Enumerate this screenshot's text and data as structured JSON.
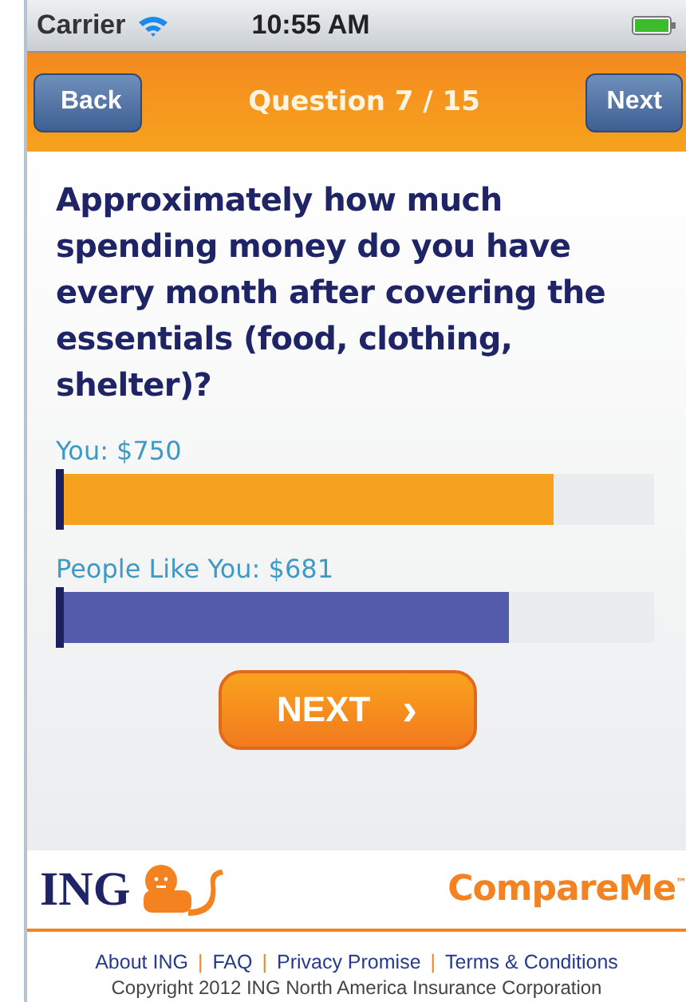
{
  "status_bar": {
    "carrier": "Carrier",
    "time": "10:55 AM"
  },
  "nav_bar": {
    "back": "Back",
    "title": "Question 7 / 15",
    "next": "Next"
  },
  "question": "Approximately how much spending money do you have every month after covering the essentials (food, clothing, shelter)?",
  "results": [
    {
      "label": "You: $750",
      "level": 0.83,
      "color": "#f7a21e"
    },
    {
      "label": "People Like You: $681",
      "level": 0.755,
      "color": "#535bab"
    }
  ],
  "next_button": "NEXT",
  "next_arrow": "›",
  "logos": {
    "brand": "ING",
    "product": "CompareMe$^{™}$"
  },
  "footer_links": [
    "About ING",
    "FAQ",
    "Privacy Promise",
    "Terms & Conditions"
  ],
  "link_separator": "|",
  "copyright": "Copyright 2012 ING North America Insurance Corporation"
}
